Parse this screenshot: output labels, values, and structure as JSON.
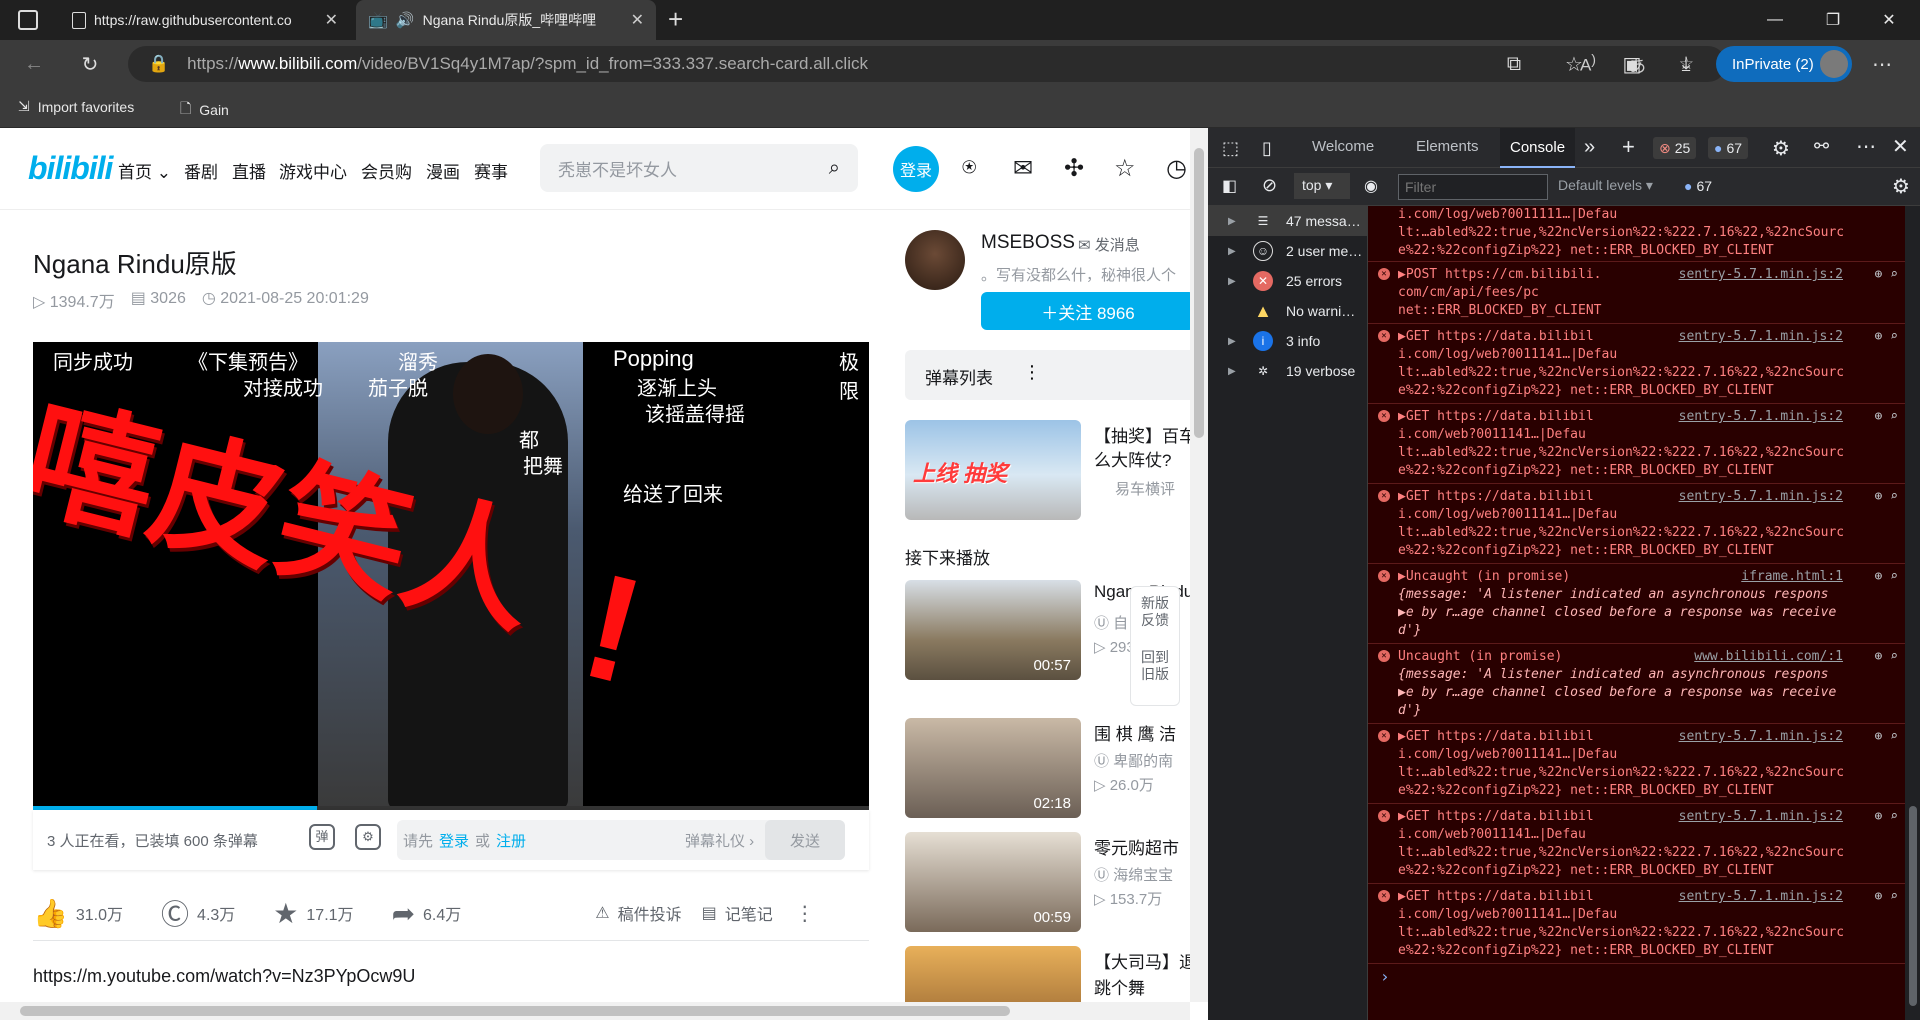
{
  "browser": {
    "tabs": [
      {
        "title": "https://raw.githubusercontent.co",
        "close": "✕"
      },
      {
        "title": "Ngana Rindu原版_哔哩哔哩",
        "close": "✕"
      }
    ],
    "new_tab": "+",
    "url_prefix": "https://",
    "url_domain": "www.bilibili.com",
    "url_path": "/video/BV1Sq4y1M7ap/?spm_id_from=333.337.search-card.all.click",
    "inprivate_label": "InPrivate (2)",
    "favorites": [
      "Import favorites",
      "Gain"
    ]
  },
  "bili": {
    "logo": "bilibili",
    "nav": [
      "首页",
      "番剧",
      "直播",
      "游戏中心",
      "会员购",
      "漫画",
      "赛事"
    ],
    "search_placeholder": "秃崽不是坏女人",
    "login": "登录",
    "video_title": "Ngana Rindu原版",
    "views": "1394.7万",
    "danmaku_count": "3026",
    "date": "2021-08-25 20:01:29",
    "overlay": {
      "left_top1": "同步成功",
      "left_top2": "《下集预告》",
      "left_mid": "对接成功",
      "center1": "茄子脱",
      "center2": "溜秀",
      "right1": "Popping",
      "right2": "逐渐上头",
      "right3": "该摇盖得摇",
      "right4": "极限",
      "big": "嘻皮笑人",
      "sent": "给送了回来",
      "dou": "都",
      "mouth": "把舞"
    },
    "dm_status": "3 人正在看，已装填 600 条弹幕",
    "dm_input_prefix": "请先",
    "dm_login": "登录",
    "dm_or": "或",
    "dm_register": "注册",
    "dm_etiquette": "弹幕礼仪 ›",
    "dm_send": "发送",
    "likes": "31.0万",
    "coins": "4.3万",
    "favs": "17.1万",
    "shares": "6.4万",
    "report": "稿件投诉",
    "notes": "记笔记",
    "description": "https://m.youtube.com/watch?v=Nz3PYpOcw9U",
    "uploader": "MSEBOSS",
    "message": "发消息",
    "uploader_sig": "。写有没都么什，秘神很人个",
    "follow": "＋关注 8966",
    "danmaku_list": "弹幕列表",
    "ad_title1": "【抽奖】百车",
    "ad_title2": "么大阵仗?",
    "ad_sub": "易车横评",
    "ad_banner": "上线 抽奖",
    "next_play": "接下来播放",
    "feedback": "新版反馈",
    "back_old": "回到旧版",
    "recs": [
      {
        "title": "Ngana Rindu",
        "sub": "自",
        "views": "293.7万",
        "dur": "00:57"
      },
      {
        "title": "围 棋 鹰 洁",
        "sub": "卑鄙的南",
        "views": "26.0万",
        "dur": "02:18"
      },
      {
        "title": "零元购超市",
        "sub": "海绵宝宝",
        "views": "153.7万",
        "dur": "00:59"
      },
      {
        "title": "【大司马】退",
        "sub": "跳个舞",
        "views": "",
        "dur": ""
      }
    ]
  },
  "devtools": {
    "tabs": [
      "Welcome",
      "Elements",
      "Console"
    ],
    "errors": "25",
    "messages": "67",
    "context": "top",
    "filter_placeholder": "Filter",
    "levels": "Default levels",
    "issues": "67",
    "sidebar": [
      {
        "label": "47 messa…",
        "icon": "list"
      },
      {
        "label": "2 user me…",
        "icon": "user"
      },
      {
        "label": "25 errors",
        "icon": "error"
      },
      {
        "label": "No warni…",
        "icon": "warning"
      },
      {
        "label": "3 info",
        "icon": "info"
      },
      {
        "label": "19 verbose",
        "icon": "bug"
      }
    ],
    "console": [
      {
        "lines": [
          "i.com/log/web?0011111…|Defau",
          "lt:…abled%22:true,%22ncVersion%22:%222.7.16%22,%22ncSourc",
          "e%22:%22configZip%22}  net::ERR_BLOCKED_BY_CLIENT"
        ],
        "method": "",
        "src": ""
      },
      {
        "lines": [
          "▶POST https://cm.bilibili.",
          "com/cm/api/fees/pc",
          "net::ERR_BLOCKED_BY_CLIENT"
        ],
        "method": "POST",
        "src": "sentry-5.7.1.min.js:2"
      },
      {
        "lines": [
          "▶GET https://data.bilibil",
          "i.com/log/web?0011141…|Defau",
          "lt:…abled%22:true,%22ncVersion%22:%222.7.16%22,%22ncSourc",
          "e%22:%22configZip%22}  net::ERR_BLOCKED_BY_CLIENT"
        ],
        "method": "GET",
        "src": "sentry-5.7.1.min.js:2"
      },
      {
        "lines": [
          "▶GET https://data.bilibil",
          "i.com/web?0011141…|Defau",
          "lt:…abled%22:true,%22ncVersion%22:%222.7.16%22,%22ncSourc",
          "e%22:%22configZip%22}  net::ERR_BLOCKED_BY_CLIENT"
        ],
        "method": "GET",
        "src": "sentry-5.7.1.min.js:2"
      },
      {
        "lines": [
          "▶GET https://data.bilibil",
          "i.com/log/web?0011141…|Defau",
          "lt:…abled%22:true,%22ncVersion%22:%222.7.16%22,%22ncSourc",
          "e%22:%22configZip%22}  net::ERR_BLOCKED_BY_CLIENT"
        ],
        "method": "GET",
        "src": "sentry-5.7.1.min.js:2"
      },
      {
        "lines": [
          "▶Uncaught (in promise)",
          "  {message: 'A listener indicated an asynchronous respons",
          "▶e by r…age channel closed before a response was receive",
          "  d'}"
        ],
        "method": "",
        "src": "iframe.html:1"
      },
      {
        "lines": [
          "Uncaught (in promise)",
          "  {message: 'A listener indicated an asynchronous respons",
          "▶e by r…age channel closed before a response was receive",
          "  d'}"
        ],
        "method": "",
        "src": "www.bilibili.com/:1"
      },
      {
        "lines": [
          "▶GET https://data.bilibil",
          "i.com/log/web?0011141…|Defau",
          "lt:…abled%22:true,%22ncVersion%22:%222.7.16%22,%22ncSourc",
          "e%22:%22configZip%22}  net::ERR_BLOCKED_BY_CLIENT"
        ],
        "method": "GET",
        "src": "sentry-5.7.1.min.js:2"
      },
      {
        "lines": [
          "▶GET https://data.bilibil",
          "i.com/web?0011141…|Defau",
          "lt:…abled%22:true,%22ncVersion%22:%222.7.16%22,%22ncSourc",
          "e%22:%22configZip%22}  net::ERR_BLOCKED_BY_CLIENT"
        ],
        "method": "GET",
        "src": "sentry-5.7.1.min.js:2"
      },
      {
        "lines": [
          "▶GET https://data.bilibil",
          "i.com/log/web?0011141…|Defau",
          "lt:…abled%22:true,%22ncVersion%22:%222.7.16%22,%22ncSourc",
          "e%22:%22configZip%22}  net::ERR_BLOCKED_BY_CLIENT"
        ],
        "method": "GET",
        "src": "sentry-5.7.1.min.js:2"
      }
    ],
    "prompt": "›"
  }
}
